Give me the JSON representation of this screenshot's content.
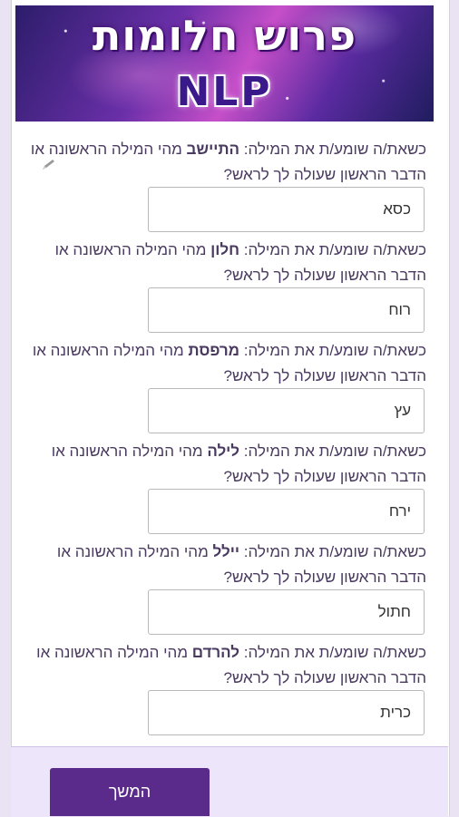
{
  "header": {
    "title": "פרוש חלומות",
    "subtitle": "NLP"
  },
  "questions": [
    {
      "prefix": "כשאת/ה שומע/ת את המילה: ",
      "word": "התיישב",
      "suffix": " מהי המילה הראשונה או הדבר הראשון שעולה לך לראש?",
      "answer": "כסא"
    },
    {
      "prefix": "כשאת/ה שומע/ת את המילה: ",
      "word": "חלון",
      "suffix": " מהי המילה הראשונה או הדבר הראשון שעולה לך לראש?",
      "answer": "רוח"
    },
    {
      "prefix": "כשאת/ה שומע/ת את המילה: ",
      "word": "מרפסת",
      "suffix": " מהי המילה הראשונה או הדבר הראשון שעולה לך לראש?",
      "answer": "עץ"
    },
    {
      "prefix": "כשאת/ה שומע/ת את המילה: ",
      "word": "לילה",
      "suffix": " מהי המילה הראשונה או הדבר הראשון שעולה לך לראש?",
      "answer": "ירח"
    },
    {
      "prefix": "כשאת/ה שומע/ת את המילה: ",
      "word": "יילל",
      "suffix": " מהי המילה הראשונה או הדבר הראשון שעולה לך לראש?",
      "answer": "חתול"
    },
    {
      "prefix": "כשאת/ה שומע/ת את המילה: ",
      "word": "להרדם",
      "suffix": " מהי המילה הראשונה או הדבר הראשון שעולה לך לראש?",
      "answer": "כרית"
    }
  ],
  "footer": {
    "continue_label": "המשך"
  },
  "icons": {
    "edit": "pencil-icon"
  },
  "colors": {
    "button": "#5b2b8c",
    "footer_bg": "#ede6fa",
    "text": "#4a3a60"
  }
}
